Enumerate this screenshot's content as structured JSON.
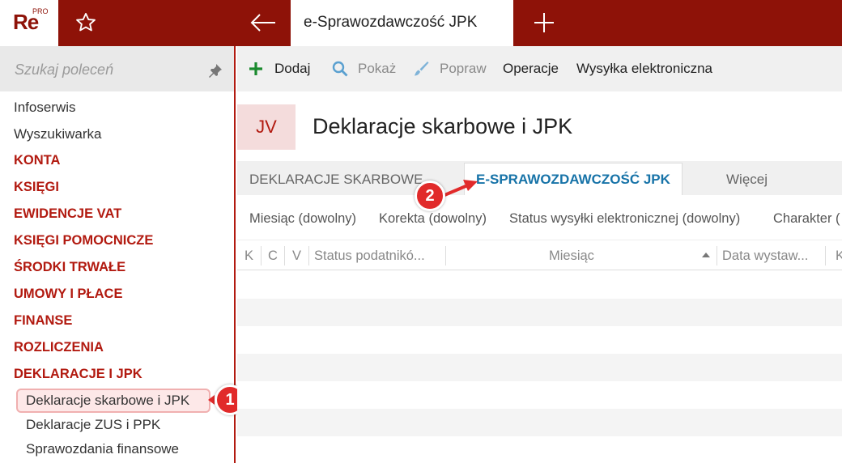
{
  "app": {
    "logo_text": "Re",
    "logo_badge": "PRO",
    "active_tab_title": "e-Sprawozdawczość JPK",
    "brand_color": "#8e1208"
  },
  "sidebar": {
    "search_placeholder": "Szukaj poleceń",
    "items": [
      {
        "label": "Infoserwis"
      },
      {
        "label": "Wyszukiwarka"
      },
      {
        "label": "KONTA"
      },
      {
        "label": "KSIĘGI"
      },
      {
        "label": "EWIDENCJE VAT"
      },
      {
        "label": "KSIĘGI POMOCNICZE"
      },
      {
        "label": "ŚRODKI TRWAŁE"
      },
      {
        "label": "UMOWY I PŁACE"
      },
      {
        "label": "FINANSE"
      },
      {
        "label": "ROZLICZENIA"
      },
      {
        "label": "DEKLARACJE I JPK"
      },
      {
        "label": "Deklaracje skarbowe i JPK"
      },
      {
        "label": "Deklaracje ZUS i PPK"
      },
      {
        "label": "Sprawozdania finansowe"
      }
    ]
  },
  "toolbar": {
    "add_label": "Dodaj",
    "show_label": "Pokaż",
    "edit_label": "Popraw",
    "operations_label": "Operacje",
    "send_label": "Wysyłka elektroniczna"
  },
  "header": {
    "badge": "JV",
    "title": "Deklaracje skarbowe i JPK"
  },
  "tabs": {
    "tab1": "DEKLARACJE SKARBOWE",
    "tab2": "E-SPRAWOZDAWCZOŚĆ JPK",
    "more": "Więcej"
  },
  "filters": {
    "month": "Miesiąc (dowolny)",
    "correction": "Korekta (dowolny)",
    "status": "Status wysyłki elektronicznej (dowolny)",
    "character": "Charakter ("
  },
  "grid": {
    "columns": [
      "K",
      "C",
      "V",
      "Status podatnikó...",
      "Miesiąc",
      "Data wystaw...",
      "K"
    ]
  },
  "callouts": {
    "first": "1",
    "second": "2"
  }
}
